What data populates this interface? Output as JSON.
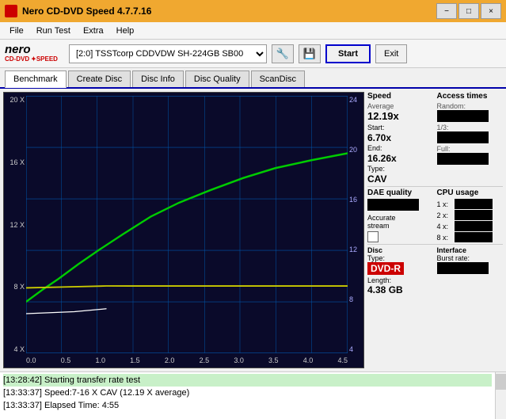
{
  "window": {
    "title": "Nero CD-DVD Speed 4.7.7.16",
    "min_btn": "−",
    "max_btn": "□",
    "close_btn": "×"
  },
  "menu": {
    "items": [
      "File",
      "Run Test",
      "Extra",
      "Help"
    ]
  },
  "toolbar": {
    "drive_label": "[2:0]  TSSTcorp CDDVDW SH-224GB SB00",
    "start_label": "Start",
    "exit_label": "Exit"
  },
  "tabs": {
    "items": [
      "Benchmark",
      "Create Disc",
      "Disc Info",
      "Disc Quality",
      "ScanDisc"
    ],
    "active": "Benchmark"
  },
  "chart": {
    "y_left_labels": [
      "20 X",
      "16 X",
      "12 X",
      "8 X",
      "4 X",
      ""
    ],
    "y_right_labels": [
      "24",
      "20",
      "16",
      "12",
      "8",
      "4"
    ],
    "x_labels": [
      "0.0",
      "0.5",
      "1.0",
      "1.5",
      "2.0",
      "2.5",
      "3.0",
      "3.5",
      "4.0",
      "4.5"
    ]
  },
  "speed_panel": {
    "title": "Speed",
    "average_label": "Average",
    "average_value": "12.19x",
    "start_label": "Start:",
    "start_value": "6.70x",
    "end_label": "End:",
    "end_value": "16.26x",
    "type_label": "Type:",
    "type_value": "CAV"
  },
  "access_times": {
    "title": "Access times",
    "random_label": "Random:",
    "one_third_label": "1/3:",
    "full_label": "Full:"
  },
  "dae": {
    "title": "DAE quality",
    "accurate_label": "Accurate",
    "stream_label": "stream"
  },
  "cpu": {
    "title": "CPU usage",
    "x1_label": "1 x:",
    "x2_label": "2 x:",
    "x4_label": "4 x:",
    "x8_label": "8 x:"
  },
  "disc": {
    "title": "Disc",
    "type_label": "Type:",
    "type_value": "DVD-R",
    "length_label": "Length:",
    "length_value": "4.38 GB"
  },
  "interface": {
    "title": "Interface",
    "burst_label": "Burst rate:"
  },
  "log": {
    "lines": [
      "[13:28:42]  Starting transfer rate test",
      "[13:33:37]  Speed:7-16 X CAV (12.19 X average)",
      "[13:33:37]  Elapsed Time: 4:55"
    ]
  }
}
